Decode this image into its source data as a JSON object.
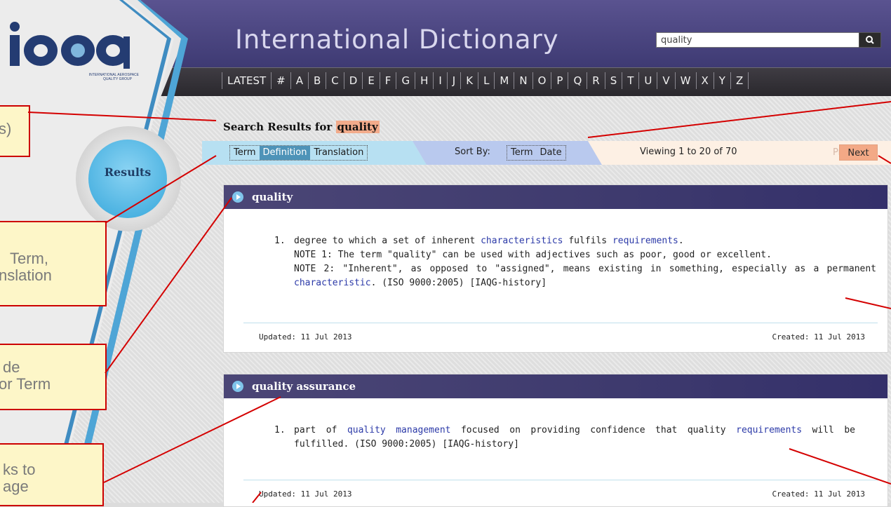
{
  "header": {
    "site_title": "International Dictionary",
    "search_value": "quality"
  },
  "logo": {
    "mark": "iaqg",
    "subtitle_line1": "INTERNATIONAL AEROSPACE",
    "subtitle_line2": "QUALITY GROUP"
  },
  "alphabet": [
    "LATEST",
    "#",
    "A",
    "B",
    "C",
    "D",
    "E",
    "F",
    "G",
    "H",
    "I",
    "J",
    "K",
    "L",
    "M",
    "N",
    "O",
    "P",
    "Q",
    "R",
    "S",
    "T",
    "U",
    "V",
    "W",
    "X",
    "Y",
    "Z"
  ],
  "sidebar": {
    "results_label": "Results"
  },
  "search_results": {
    "prefix": "Search Results for",
    "query": "quality"
  },
  "filters": {
    "tabs": [
      "Term",
      "Definition",
      "Translation"
    ],
    "active_tab": "Definition",
    "sort_label": "Sort By:",
    "sort_options": [
      "Term",
      "Date"
    ],
    "viewing": "Viewing 1 to 20 of 70",
    "prev": "Prev",
    "next": "Next"
  },
  "entries": [
    {
      "title": "quality",
      "num": "1.",
      "p1": "degree to which a set of inherent ",
      "link1": "characteristics",
      "p2": " fulfils ",
      "link2": "requirements",
      "p3": ".",
      "note1": "NOTE 1: The term \"quality\" can be used with adjectives such as poor, good or excellent.",
      "note2a": "NOTE 2: \"Inherent\", as opposed to \"assigned\", means existing in something, especially as a permanent ",
      "link3": "characteristic",
      "note2b": ". (ISO 9000:2005) [IAQG-history]",
      "updated": "Updated: 11 Jul 2013",
      "created": "Created: 11 Jul 2013"
    },
    {
      "title": "quality assurance",
      "num": "1.",
      "p1": "part of ",
      "link1": "quality management",
      "p2": " focused on providing confidence that quality ",
      "link2": "requirements",
      "p3": " will be fulfilled. (ISO 9000:2005) [IAQG-history]",
      "updated": "Updated: 11 Jul 2013",
      "created": "Created: 11 Jul 2013"
    }
  ],
  "callouts": [
    {
      "line1": "s)"
    },
    {
      "line1": "Term,",
      "line2": "nslation"
    },
    {
      "line1": "de",
      "line2": "or Term"
    },
    {
      "line1": "ks to",
      "line2": "age"
    }
  ]
}
